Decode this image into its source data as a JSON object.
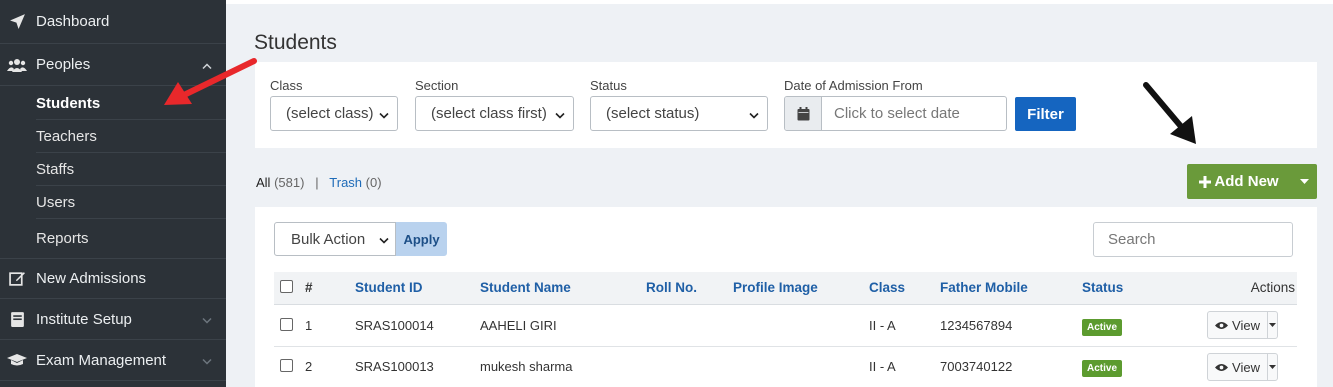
{
  "sidebar": {
    "items": [
      {
        "label": "Dashboard",
        "icon": "paper-plane-icon"
      },
      {
        "label": "Peoples",
        "icon": "users-icon"
      },
      {
        "label": "New Admissions",
        "icon": "edit-icon"
      },
      {
        "label": "Institute Setup",
        "icon": "book-icon"
      },
      {
        "label": "Exam Management",
        "icon": "graduation-cap-icon"
      }
    ],
    "sub_items": [
      "Students",
      "Teachers",
      "Staffs",
      "Users",
      "Reports"
    ],
    "active": "Students"
  },
  "page": {
    "title": "Students"
  },
  "filters": {
    "class_label": "Class",
    "class_value": "(select class)",
    "section_label": "Section",
    "section_value": "(select class first)",
    "status_label": "Status",
    "status_value": "(select status)",
    "date_label": "Date of Admission From",
    "date_placeholder": "Click to select date",
    "filter_button": "Filter"
  },
  "counts": {
    "all_label": "All",
    "all_count": "(581)",
    "separator": "|",
    "trash_label": "Trash",
    "trash_count": "(0)"
  },
  "add_new": {
    "label": "Add New"
  },
  "bulk": {
    "value": "Bulk Action",
    "apply": "Apply"
  },
  "search": {
    "placeholder": "Search"
  },
  "table": {
    "columns": [
      "#",
      "Student ID",
      "Student Name",
      "Roll No.",
      "Profile Image",
      "Class",
      "Father Mobile",
      "Status",
      "Actions"
    ],
    "rows": [
      {
        "num": "1",
        "student_id": "SRAS100014",
        "name": "AAHELI GIRI",
        "roll": "",
        "class": "II - A",
        "mobile": "1234567894",
        "status": "Active",
        "action": "View"
      },
      {
        "num": "2",
        "student_id": "SRAS100013",
        "name": "mukesh sharma",
        "roll": "",
        "class": "II - A",
        "mobile": "7003740122",
        "status": "Active",
        "action": "View"
      }
    ]
  },
  "colors": {
    "sidebar_bg": "#2c3238",
    "primary": "#1565c0",
    "success": "#6a9a3a",
    "link": "#1f5fa6",
    "annotation_red": "#e8282b"
  }
}
